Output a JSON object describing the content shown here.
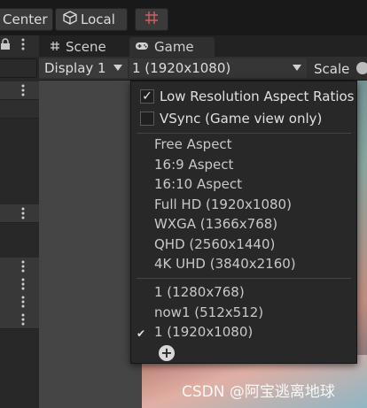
{
  "toolbar": {
    "center_label": "Center",
    "local_label": "Local"
  },
  "tabs": {
    "scene_label": "Scene",
    "game_label": "Game"
  },
  "game_toolbar": {
    "display_label": "Display 1",
    "resolution_label": "1 (1920x1080)",
    "scale_label": "Scale"
  },
  "aspect_menu": {
    "low_res_label": "Low Resolution Aspect Ratios",
    "low_res_checked": true,
    "vsync_label": "VSync (Game view only)",
    "vsync_checked": false,
    "builtin_options": [
      "Free Aspect",
      "16:9 Aspect",
      "16:10 Aspect",
      "Full HD (1920x1080)",
      "WXGA (1366x768)",
      "QHD (2560x1440)",
      "4K UHD (3840x2160)"
    ],
    "custom_options": [
      "1 (1280x768)",
      "now1 (512x512)",
      "1 (1920x1080)"
    ],
    "selected_option": "1 (1920x1080)"
  },
  "watermark": "CSDN @阿宝逃离地球"
}
